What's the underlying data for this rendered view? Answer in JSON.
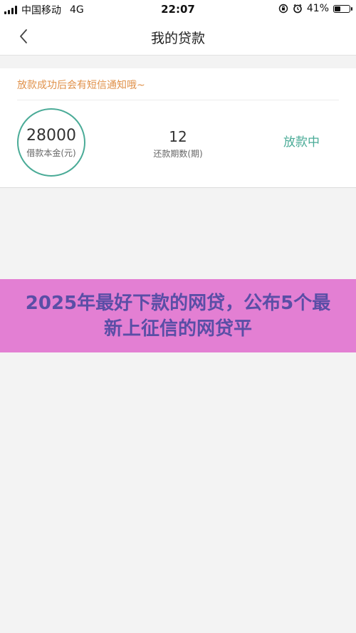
{
  "status_bar": {
    "carrier": "中国移动",
    "network": "4G",
    "time": "22:07",
    "battery_percent": "41%",
    "battery_level": 0.41
  },
  "header": {
    "title": "我的贷款",
    "back_icon": "chevron-left-icon"
  },
  "loan": {
    "notice": "放款成功后会有短信通知哦~",
    "amount": "28000",
    "amount_label": "借款本金(元)",
    "term": "12",
    "term_label": "还款期数(期)",
    "status": "放款中"
  },
  "banner": {
    "text": "2025年最好下款的网贷，公布5个最新上征信的网贷平"
  },
  "colors": {
    "accent": "#4aab97",
    "notice": "#e0914a",
    "banner_bg": "#e37fd3",
    "banner_text": "#5a4ea6"
  }
}
